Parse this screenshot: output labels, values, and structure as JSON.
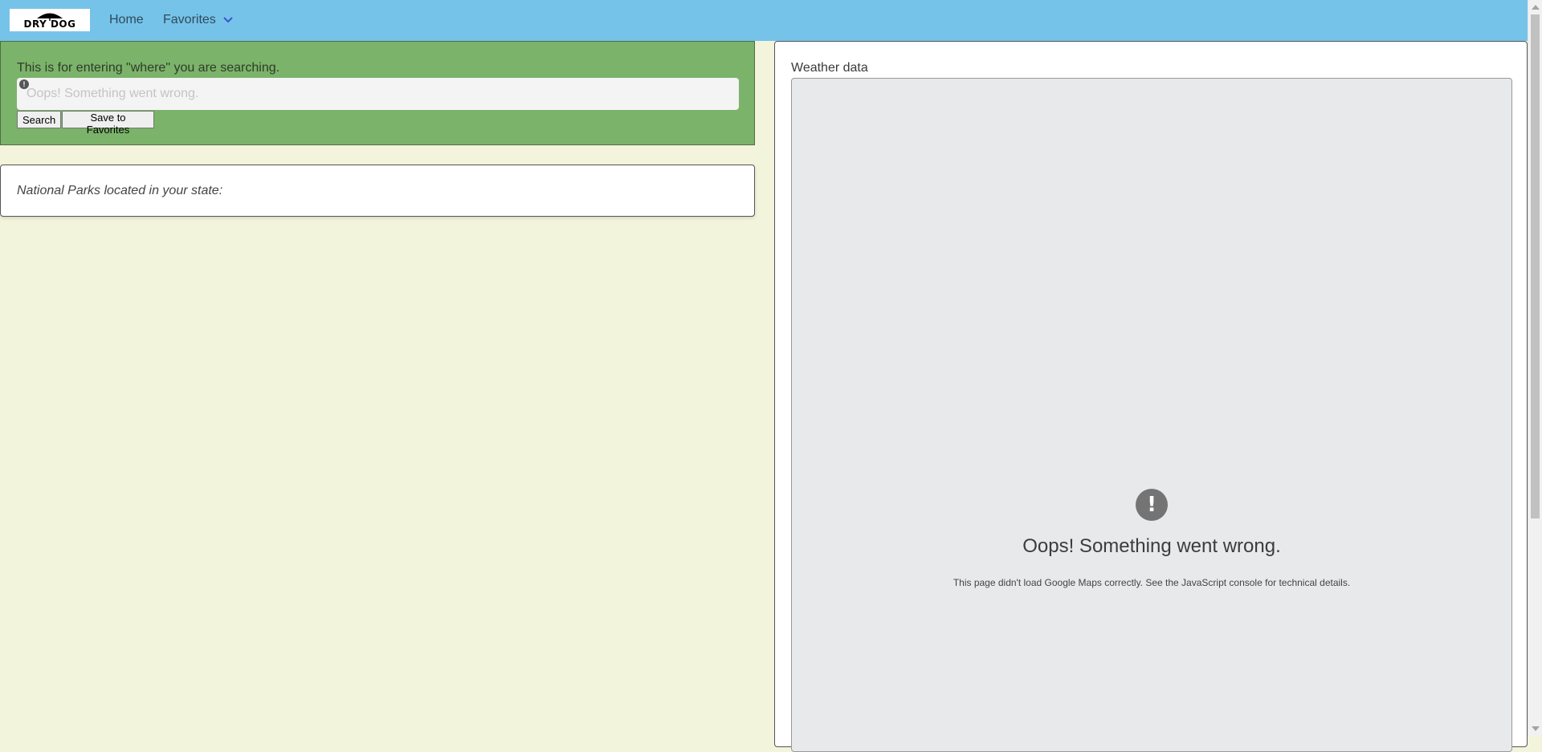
{
  "nav": {
    "logo_text": "DRY DOG",
    "home_label": "Home",
    "favorites_label": "Favorites"
  },
  "search": {
    "description": "This is for entering \"where\" you are searching.",
    "input_placeholder": "Oops! Something went wrong.",
    "error_glyph": "!",
    "search_button": "Search",
    "save_button": "Save to Favorites"
  },
  "parks": {
    "label": "National Parks located in your state:"
  },
  "weather": {
    "label": "Weather data",
    "error_glyph": "!",
    "error_title": "Oops! Something went wrong.",
    "error_text": "This page didn't load Google Maps correctly. See the JavaScript console for technical details."
  },
  "colors": {
    "navbar": "#76c3e9",
    "search_panel": "#7bb36a",
    "page_background": "#f3f4dc",
    "map_background": "#e8e9eb"
  },
  "icons": {
    "logo": "umbrella-icon",
    "favorites_dropdown": "chevron-down-icon",
    "input_error": "exclamation-icon",
    "map_error": "exclamation-circle-icon"
  }
}
